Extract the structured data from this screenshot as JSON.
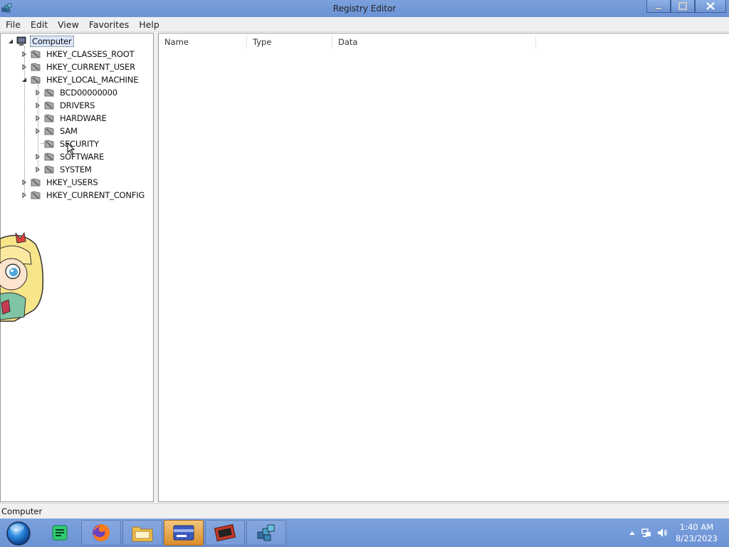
{
  "window": {
    "title": "Registry Editor",
    "controls": [
      "minimize",
      "maximize",
      "close"
    ]
  },
  "menu": [
    "File",
    "Edit",
    "View",
    "Favorites",
    "Help"
  ],
  "tree": {
    "root": "Computer",
    "hives": [
      {
        "label": "HKEY_CLASSES_ROOT",
        "expanded": false
      },
      {
        "label": "HKEY_CURRENT_USER",
        "expanded": false
      },
      {
        "label": "HKEY_LOCAL_MACHINE",
        "expanded": true,
        "children": [
          {
            "label": "BCD00000000",
            "has_children": true
          },
          {
            "label": "DRIVERS",
            "has_children": true
          },
          {
            "label": "HARDWARE",
            "has_children": true
          },
          {
            "label": "SAM",
            "has_children": true
          },
          {
            "label": "SECURITY",
            "has_children": false
          },
          {
            "label": "SOFTWARE",
            "has_children": true
          },
          {
            "label": "SYSTEM",
            "has_children": true
          }
        ]
      },
      {
        "label": "HKEY_USERS",
        "expanded": false
      },
      {
        "label": "HKEY_CURRENT_CONFIG",
        "expanded": false
      }
    ],
    "selected": "Computer"
  },
  "values_pane": {
    "columns": [
      "Name",
      "Type",
      "Data"
    ]
  },
  "status_bar": {
    "path": "Computer"
  },
  "taskbar": {
    "start_icon": "start-orb-icon",
    "apps": [
      {
        "name": "notes-app-icon",
        "color": "#2ecc71"
      },
      {
        "name": "firefox-icon",
        "color": "#ff7a1a"
      },
      {
        "name": "file-explorer-icon",
        "color": "#f2c14e"
      },
      {
        "name": "card-app-icon",
        "color": "#3b5bbf",
        "active": true
      },
      {
        "name": "media-app-icon",
        "color": "#c0392b"
      },
      {
        "name": "registry-editor-icon",
        "color": "#4aa0c8"
      }
    ],
    "tray_icons": [
      "show-hidden-icons",
      "network-icon",
      "volume-icon"
    ],
    "time": "1:40 AM",
    "date": "8/23/2023"
  },
  "colors": {
    "titlebar": "#7aa0db",
    "taskbar": "#6a92d5",
    "chrome": "#f0f0f0",
    "selection": "#dbe8fb"
  }
}
